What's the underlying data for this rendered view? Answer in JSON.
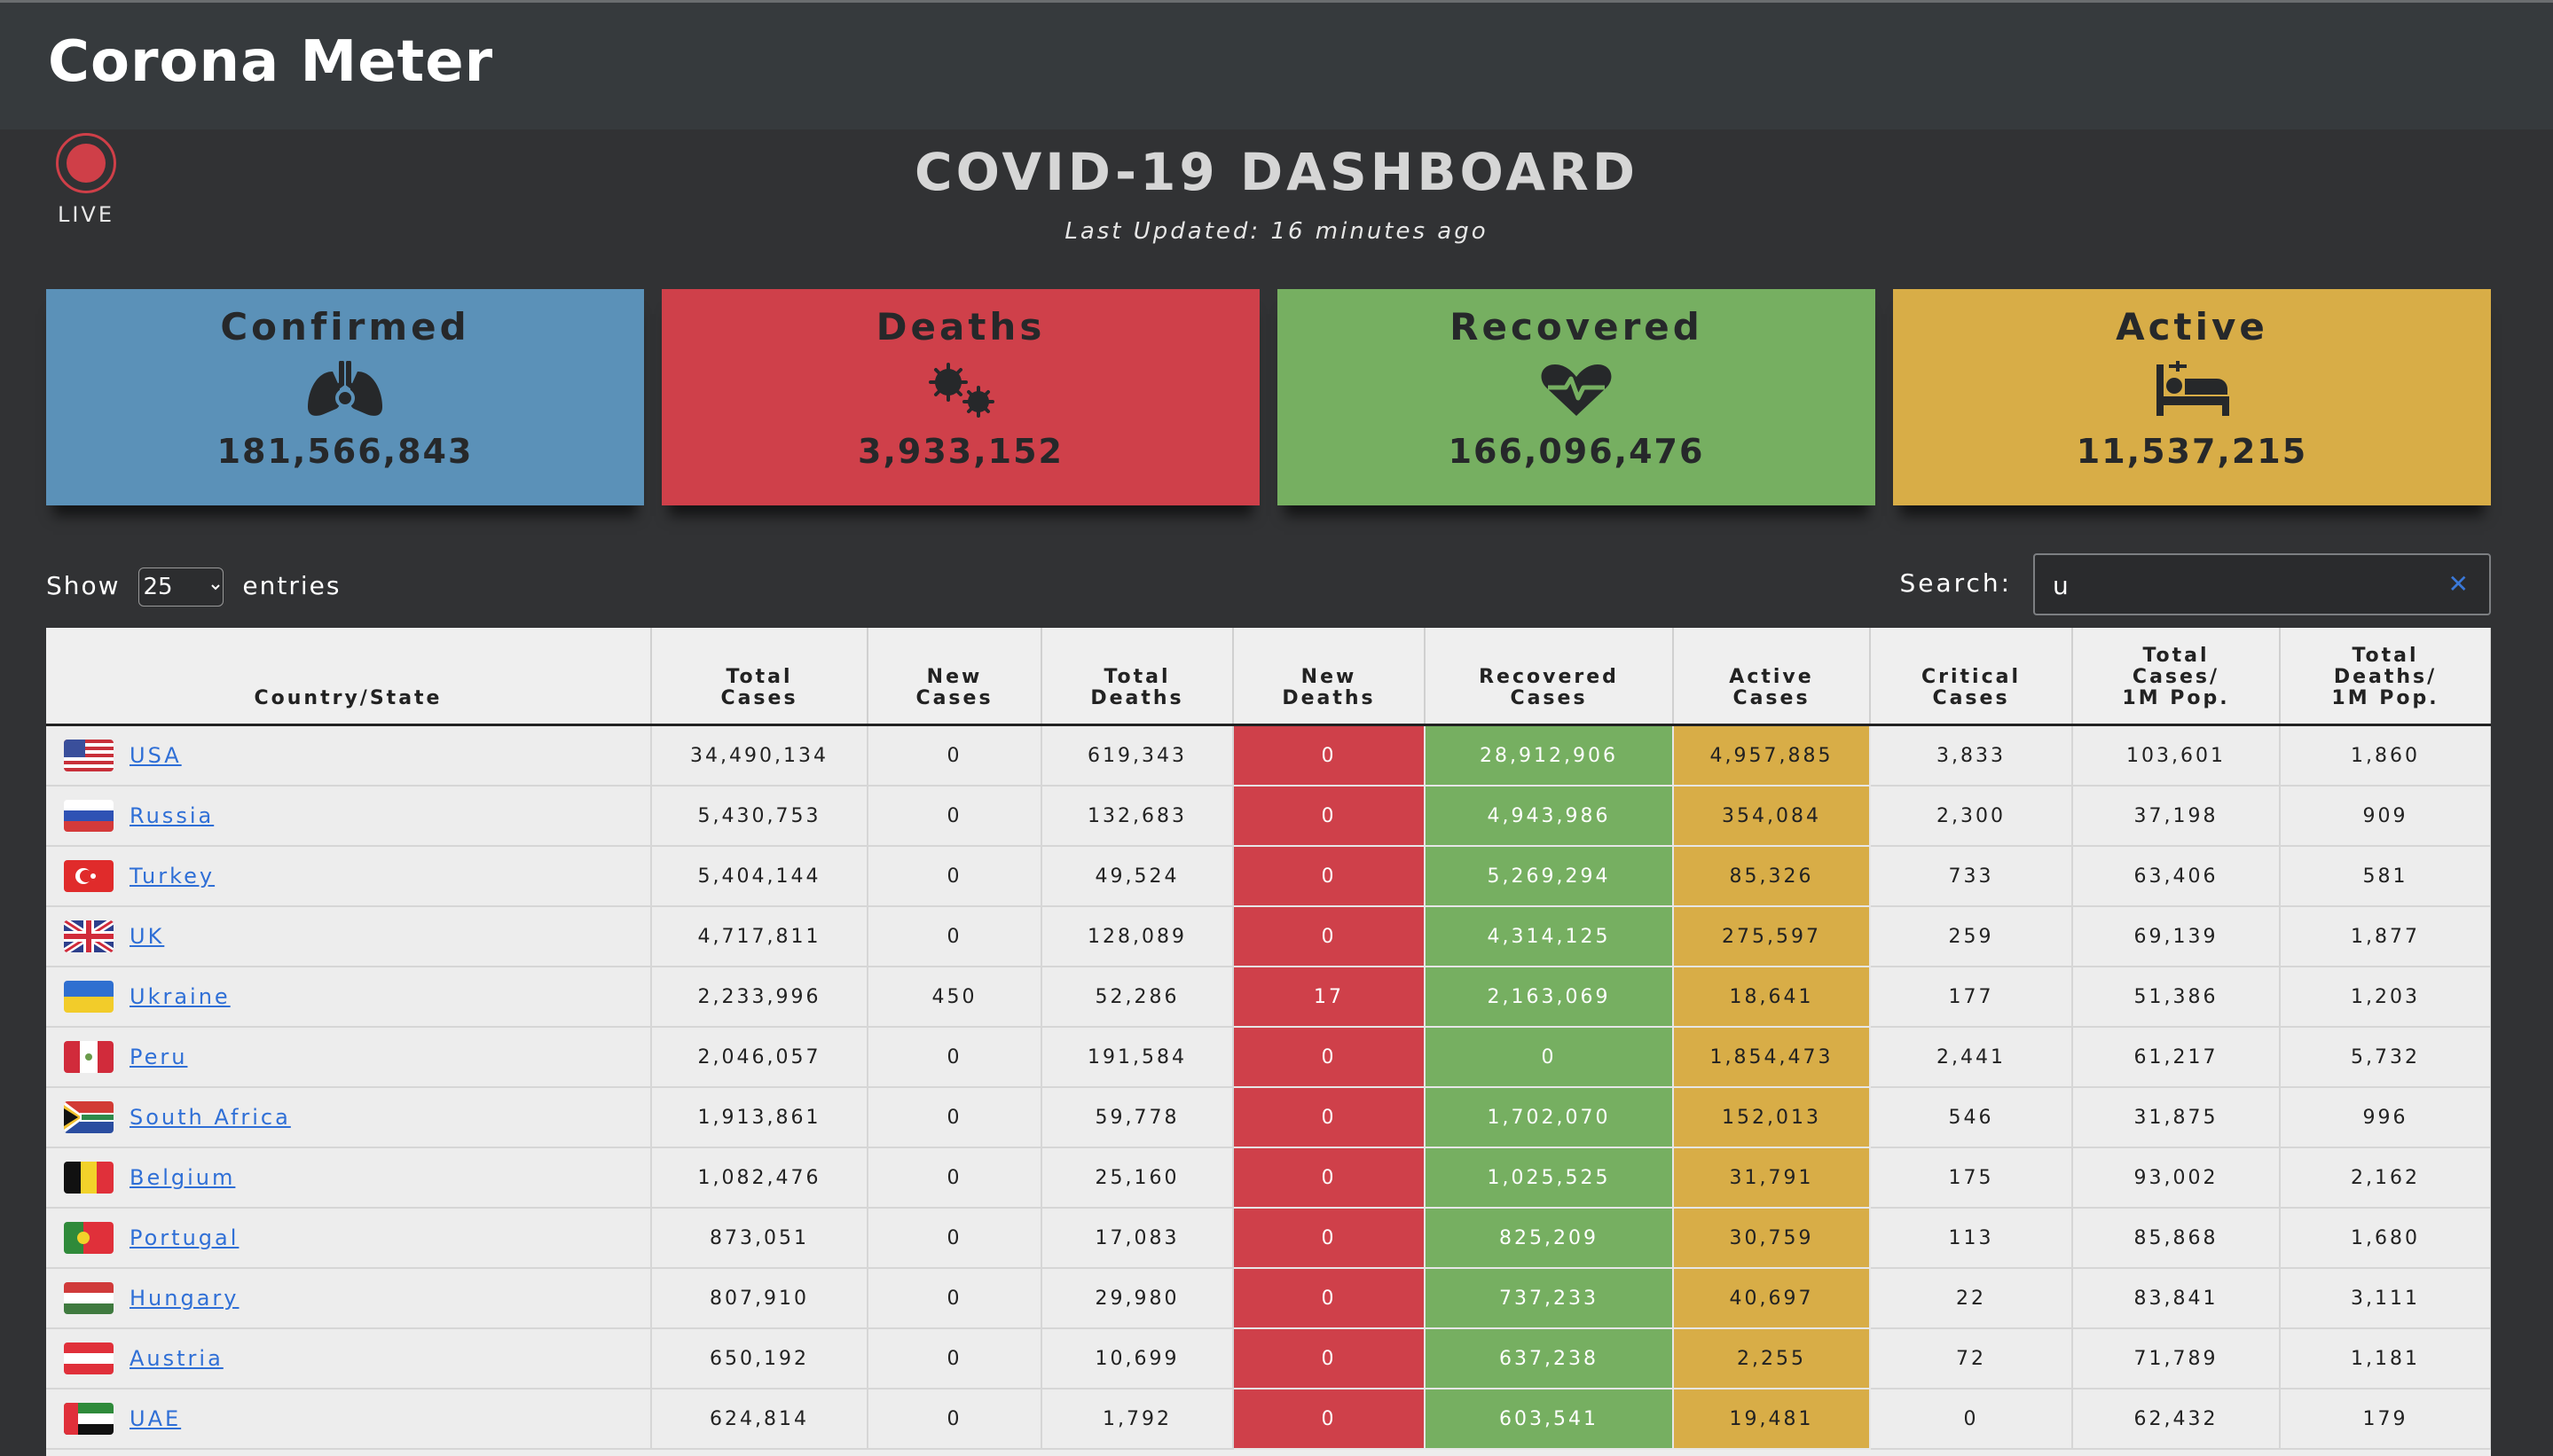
{
  "app": {
    "brand": "Corona Meter"
  },
  "live": {
    "label": "LIVE"
  },
  "dashboard": {
    "title": "COVID-19 DASHBOARD",
    "last_updated": "Last Updated: 16 minutes ago"
  },
  "cards": [
    {
      "label": "Confirmed",
      "value": "181,566,843",
      "icon": "lungs-virus-icon",
      "color": "#5b91b8"
    },
    {
      "label": "Deaths",
      "value": "3,933,152",
      "icon": "viruses-icon",
      "color": "#cf404a"
    },
    {
      "label": "Recovered",
      "value": "166,096,476",
      "icon": "heartbeat-icon",
      "color": "#76af61"
    },
    {
      "label": "Active",
      "value": "11,537,215",
      "icon": "hospital-bed-icon",
      "color": "#d8ad47"
    }
  ],
  "controls": {
    "show_label": "Show",
    "entries_value": "25",
    "entries_label": "entries",
    "search_label": "Search:",
    "search_value": "u"
  },
  "table": {
    "headers": {
      "country": "Country/State",
      "total_cases": [
        "Total",
        "Cases"
      ],
      "new_cases": [
        "New",
        "Cases"
      ],
      "total_deaths": [
        "Total",
        "Deaths"
      ],
      "new_deaths": [
        "New",
        "Deaths"
      ],
      "recovered": [
        "Recovered",
        "Cases"
      ],
      "active": [
        "Active",
        "Cases"
      ],
      "critical": [
        "Critical",
        "Cases"
      ],
      "cases_per_m": [
        "Total",
        "Cases/",
        "1M Pop."
      ],
      "deaths_per_m": [
        "Total",
        "Deaths/",
        "1M Pop."
      ]
    },
    "rows": [
      {
        "flag": "us-flag-icon",
        "country": "USA",
        "total_cases": "34,490,134",
        "new_cases": "0",
        "total_deaths": "619,343",
        "new_deaths": "0",
        "recovered": "28,912,906",
        "active": "4,957,885",
        "critical": "3,833",
        "cases_per_m": "103,601",
        "deaths_per_m": "1,860"
      },
      {
        "flag": "russia-flag-icon",
        "country": "Russia",
        "total_cases": "5,430,753",
        "new_cases": "0",
        "total_deaths": "132,683",
        "new_deaths": "0",
        "recovered": "4,943,986",
        "active": "354,084",
        "critical": "2,300",
        "cases_per_m": "37,198",
        "deaths_per_m": "909"
      },
      {
        "flag": "turkey-flag-icon",
        "country": "Turkey",
        "total_cases": "5,404,144",
        "new_cases": "0",
        "total_deaths": "49,524",
        "new_deaths": "0",
        "recovered": "5,269,294",
        "active": "85,326",
        "critical": "733",
        "cases_per_m": "63,406",
        "deaths_per_m": "581"
      },
      {
        "flag": "uk-flag-icon",
        "country": "UK",
        "total_cases": "4,717,811",
        "new_cases": "0",
        "total_deaths": "128,089",
        "new_deaths": "0",
        "recovered": "4,314,125",
        "active": "275,597",
        "critical": "259",
        "cases_per_m": "69,139",
        "deaths_per_m": "1,877"
      },
      {
        "flag": "ukraine-flag-icon",
        "country": "Ukraine",
        "total_cases": "2,233,996",
        "new_cases": "450",
        "total_deaths": "52,286",
        "new_deaths": "17",
        "recovered": "2,163,069",
        "active": "18,641",
        "critical": "177",
        "cases_per_m": "51,386",
        "deaths_per_m": "1,203"
      },
      {
        "flag": "peru-flag-icon",
        "country": "Peru",
        "total_cases": "2,046,057",
        "new_cases": "0",
        "total_deaths": "191,584",
        "new_deaths": "0",
        "recovered": "0",
        "active": "1,854,473",
        "critical": "2,441",
        "cases_per_m": "61,217",
        "deaths_per_m": "5,732"
      },
      {
        "flag": "south-africa-flag-icon",
        "country": "South Africa",
        "total_cases": "1,913,861",
        "new_cases": "0",
        "total_deaths": "59,778",
        "new_deaths": "0",
        "recovered": "1,702,070",
        "active": "152,013",
        "critical": "546",
        "cases_per_m": "31,875",
        "deaths_per_m": "996"
      },
      {
        "flag": "belgium-flag-icon",
        "country": "Belgium",
        "total_cases": "1,082,476",
        "new_cases": "0",
        "total_deaths": "25,160",
        "new_deaths": "0",
        "recovered": "1,025,525",
        "active": "31,791",
        "critical": "175",
        "cases_per_m": "93,002",
        "deaths_per_m": "2,162"
      },
      {
        "flag": "portugal-flag-icon",
        "country": "Portugal",
        "total_cases": "873,051",
        "new_cases": "0",
        "total_deaths": "17,083",
        "new_deaths": "0",
        "recovered": "825,209",
        "active": "30,759",
        "critical": "113",
        "cases_per_m": "85,868",
        "deaths_per_m": "1,680"
      },
      {
        "flag": "hungary-flag-icon",
        "country": "Hungary",
        "total_cases": "807,910",
        "new_cases": "0",
        "total_deaths": "29,980",
        "new_deaths": "0",
        "recovered": "737,233",
        "active": "40,697",
        "critical": "22",
        "cases_per_m": "83,841",
        "deaths_per_m": "3,111"
      },
      {
        "flag": "austria-flag-icon",
        "country": "Austria",
        "total_cases": "650,192",
        "new_cases": "0",
        "total_deaths": "10,699",
        "new_deaths": "0",
        "recovered": "637,238",
        "active": "2,255",
        "critical": "72",
        "cases_per_m": "71,789",
        "deaths_per_m": "1,181"
      },
      {
        "flag": "uae-flag-icon",
        "country": "UAE",
        "total_cases": "624,814",
        "new_cases": "0",
        "total_deaths": "1,792",
        "new_deaths": "0",
        "recovered": "603,541",
        "active": "19,481",
        "critical": "0",
        "cases_per_m": "62,432",
        "deaths_per_m": "179"
      }
    ]
  }
}
